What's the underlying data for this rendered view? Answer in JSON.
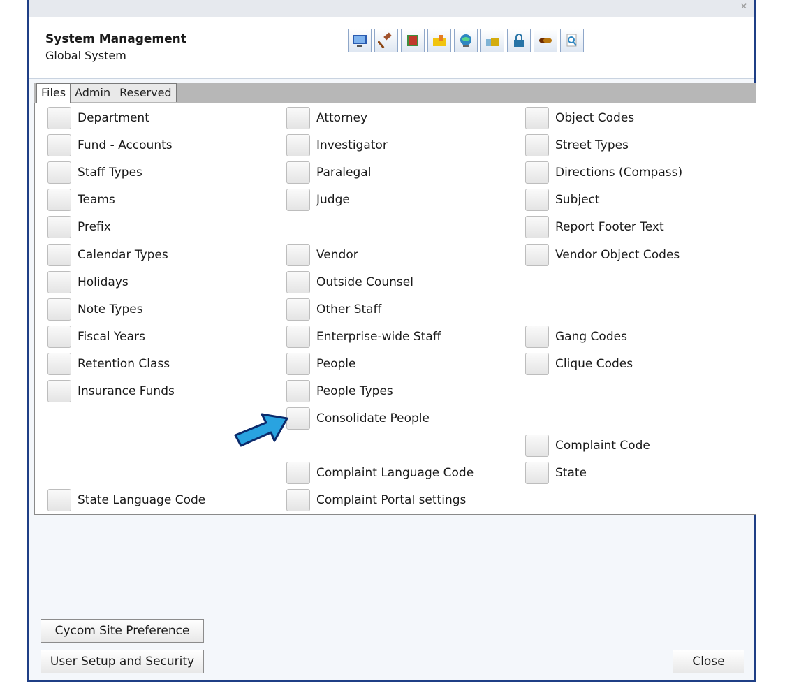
{
  "window": {
    "close_glyph": "✕"
  },
  "header": {
    "title": "System Management",
    "subtitle": "Global System"
  },
  "toolbar": {
    "icons": [
      "monitor-icon",
      "gavel-icon",
      "book-icon",
      "folder-icon",
      "globe-icon",
      "briefcase-icon",
      "lock-icon",
      "handshake-icon",
      "magnifier-icon"
    ]
  },
  "tabs": [
    {
      "label": "Files"
    },
    {
      "label": "Admin"
    },
    {
      "label": "Reserved"
    }
  ],
  "columns": {
    "left": [
      {
        "label": "Department"
      },
      {
        "label": "Fund - Accounts"
      },
      {
        "label": "Staff Types"
      },
      {
        "label": "Teams"
      },
      {
        "label": "Prefix"
      },
      {
        "label": "Calendar Types"
      },
      {
        "label": "Holidays"
      },
      {
        "label": "Note Types"
      },
      {
        "label": "Fiscal Years"
      },
      {
        "label": "Retention Class"
      },
      {
        "label": "Insurance Funds"
      },
      {
        "label": "State Language Code"
      }
    ],
    "middle": [
      {
        "label": "Attorney"
      },
      {
        "label": "Investigator"
      },
      {
        "label": "Paralegal"
      },
      {
        "label": "Judge"
      },
      {
        "label": "Vendor"
      },
      {
        "label": "Outside Counsel"
      },
      {
        "label": "Other Staff"
      },
      {
        "label": "Enterprise-wide Staff"
      },
      {
        "label": "People"
      },
      {
        "label": "People Types"
      },
      {
        "label": "Consolidate People"
      },
      {
        "label": "Complaint Language Code"
      },
      {
        "label": "Complaint Portal settings"
      }
    ],
    "right": [
      {
        "label": "Object Codes"
      },
      {
        "label": "Street Types"
      },
      {
        "label": "Directions (Compass)"
      },
      {
        "label": "Subject"
      },
      {
        "label": "Report Footer Text"
      },
      {
        "label": "Vendor Object Codes"
      },
      {
        "label": "Gang Codes"
      },
      {
        "label": "Clique Codes"
      },
      {
        "label": "Complaint Code"
      },
      {
        "label": "State"
      }
    ]
  },
  "buttons": {
    "site_pref": "Cycom Site Preference",
    "user_setup": "User Setup and Security",
    "close": "Close"
  },
  "colors": {
    "frame": "#1f3f86",
    "arrow": "#29a3e0"
  }
}
